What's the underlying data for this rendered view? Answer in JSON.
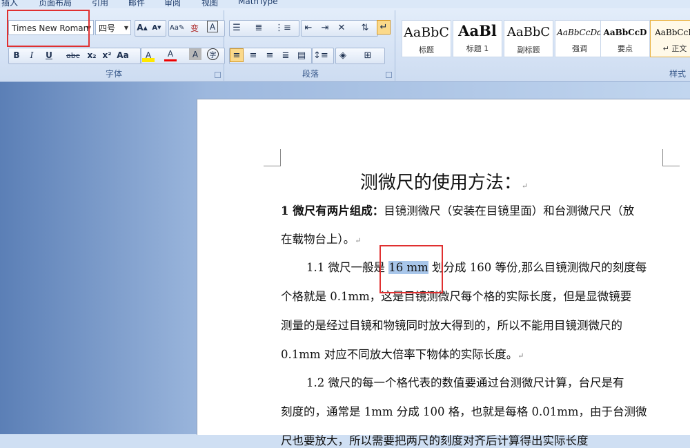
{
  "tabs": [
    "插入",
    "页面布局",
    "引用",
    "邮件",
    "审阅",
    "视图",
    "MathType"
  ],
  "font": {
    "family_value": "Times New Roman",
    "size_value": "四号",
    "group_label": "字体",
    "buttons": [
      "B",
      "I",
      "U",
      "abc",
      "x₂",
      "x²",
      "Aa",
      "A",
      "A",
      "A"
    ]
  },
  "paragraph": {
    "group_label": "段落"
  },
  "styles": {
    "group_label": "样式",
    "items": [
      {
        "sample": "AaBbC",
        "name": "标题"
      },
      {
        "sample": "AaBl",
        "name": "标题 1"
      },
      {
        "sample": "AaBbC",
        "name": "副标题"
      },
      {
        "sample": "AaBbCcDd",
        "name": "强调"
      },
      {
        "sample": "AaBbCcD",
        "name": "要点"
      },
      {
        "sample": "AaBbCcD",
        "name": "正文"
      }
    ]
  },
  "document": {
    "title": "测微尺的使用方法：",
    "p1_bold": "1 微尺有两片组成：",
    "p1_rest": "目镜测微尺（安装在目镜里面）和台测微尺尺（放",
    "p1_line2": "在载物台上）。",
    "p2_pre": "1.1 微尺一般是 ",
    "p2_sel": "16 mm",
    "p2_post": " 划分成 160 等份,那么目镜测微尺的刻度每",
    "p2_line2": "个格就是 0.1mm，这是目镜测微尺每个格的实际长度，但是显微镜要",
    "p2_line3": "测量的是经过目镜和物镜同时放大得到的，所以不能用目镜测微尺的",
    "p2_line4": "0.1mm 对应不同放大倍率下物体的实际长度。",
    "p3_line1": "1.2 微尺的每一个格代表的数值要通过台测微尺计算，台尺是有",
    "p3_line2": "刻度的，通常是 1mm 分成 100 格，也就是每格 0.01mm，由于台测微",
    "p3_line3": "尺也要放大，所以需要把两尺的刻度对齐后计算得出实际长度"
  },
  "para_mark": "↵"
}
